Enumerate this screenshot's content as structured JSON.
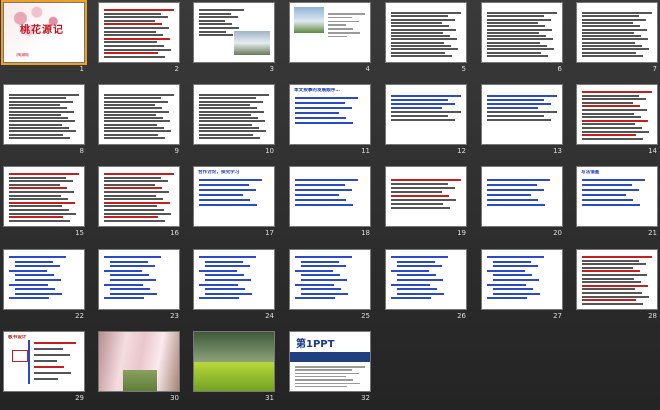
{
  "view": "slide-sorter",
  "slides": [
    {
      "n": "1",
      "title": "桃花源记",
      "kind": "cover",
      "sub": "（陶渊明）"
    },
    {
      "n": "2",
      "title": "",
      "kind": "text-red"
    },
    {
      "n": "3",
      "title": "",
      "kind": "text-photo"
    },
    {
      "n": "4",
      "title": "",
      "kind": "landscape"
    },
    {
      "n": "5",
      "title": "",
      "kind": "text"
    },
    {
      "n": "6",
      "title": "",
      "kind": "text"
    },
    {
      "n": "7",
      "title": "",
      "kind": "text"
    },
    {
      "n": "8",
      "title": "",
      "kind": "text"
    },
    {
      "n": "9",
      "title": "",
      "kind": "text"
    },
    {
      "n": "10",
      "title": "",
      "kind": "text"
    },
    {
      "n": "11",
      "title": "本文按事的发展顺序…",
      "kind": "blue-title"
    },
    {
      "n": "12",
      "title": "",
      "kind": "text-sparse"
    },
    {
      "n": "13",
      "title": "",
      "kind": "text-sparse"
    },
    {
      "n": "14",
      "title": "",
      "kind": "text-red"
    },
    {
      "n": "15",
      "title": "",
      "kind": "text-red"
    },
    {
      "n": "16",
      "title": "",
      "kind": "text-red"
    },
    {
      "n": "17",
      "title": "合作讨论，探究学习",
      "kind": "blue-title"
    },
    {
      "n": "18",
      "title": "",
      "kind": "blue-title"
    },
    {
      "n": "19",
      "title": "",
      "kind": "red-title"
    },
    {
      "n": "20",
      "title": "",
      "kind": "blue-title"
    },
    {
      "n": "21",
      "title": "写法借鉴",
      "kind": "blue-title"
    },
    {
      "n": "22",
      "title": "",
      "kind": "outline"
    },
    {
      "n": "23",
      "title": "",
      "kind": "outline"
    },
    {
      "n": "24",
      "title": "",
      "kind": "outline"
    },
    {
      "n": "25",
      "title": "",
      "kind": "outline"
    },
    {
      "n": "26",
      "title": "",
      "kind": "outline"
    },
    {
      "n": "27",
      "title": "",
      "kind": "outline"
    },
    {
      "n": "28",
      "title": "",
      "kind": "text-red"
    },
    {
      "n": "29",
      "title": "板书设计",
      "kind": "diagram"
    },
    {
      "n": "30",
      "title": "",
      "kind": "blossom-path"
    },
    {
      "n": "31",
      "title": "",
      "kind": "meadow"
    },
    {
      "n": "32",
      "title": "",
      "kind": "ppt-logo",
      "brand": "第1PPT"
    }
  ],
  "colors": {
    "red": "#c41e1e",
    "blue": "#2a4bc8",
    "selected": "#f0a020"
  }
}
